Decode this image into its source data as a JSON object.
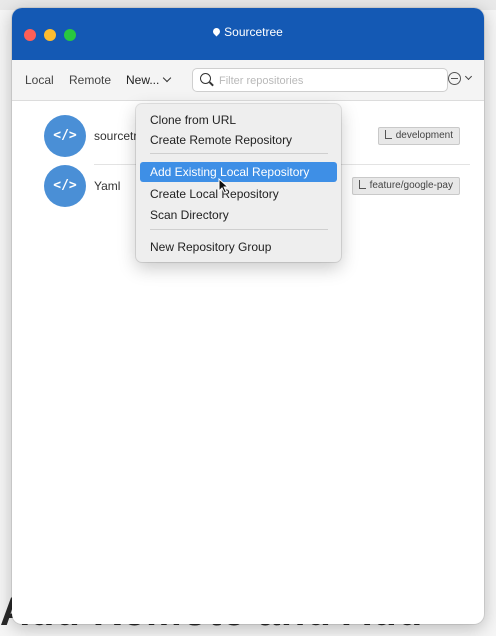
{
  "window": {
    "title": "Sourcetree"
  },
  "toolbar": {
    "local_tab": "Local",
    "remote_tab": "Remote",
    "new_menu": "New...",
    "search_placeholder": "Filter repositories"
  },
  "repositories": [
    {
      "name": "sourcetree",
      "avatar_glyph": "</>",
      "branch": "development"
    },
    {
      "name": "Yaml",
      "avatar_glyph": "</>",
      "branch": "feature/google-pay"
    }
  ],
  "new_menu": {
    "items": [
      {
        "label": "Clone from URL"
      },
      {
        "label": "Create Remote Repository"
      },
      {
        "label": "Add Existing Local Repository",
        "highlighted": true
      },
      {
        "label": "Create Local Repository"
      },
      {
        "label": "Scan Directory"
      },
      {
        "label": "New Repository Group"
      }
    ]
  },
  "background": {
    "bottom_text": "Add Remote and Add"
  },
  "colors": {
    "titlebar": "#1459b4",
    "avatar": "#4a8fd6",
    "menu_highlight": "#3e8fe6"
  },
  "icons": {
    "location": "map-pin-icon",
    "search": "search-icon",
    "filter": "filter-icon",
    "branch": "branch-icon",
    "cursor": "mouse-pointer-icon"
  }
}
